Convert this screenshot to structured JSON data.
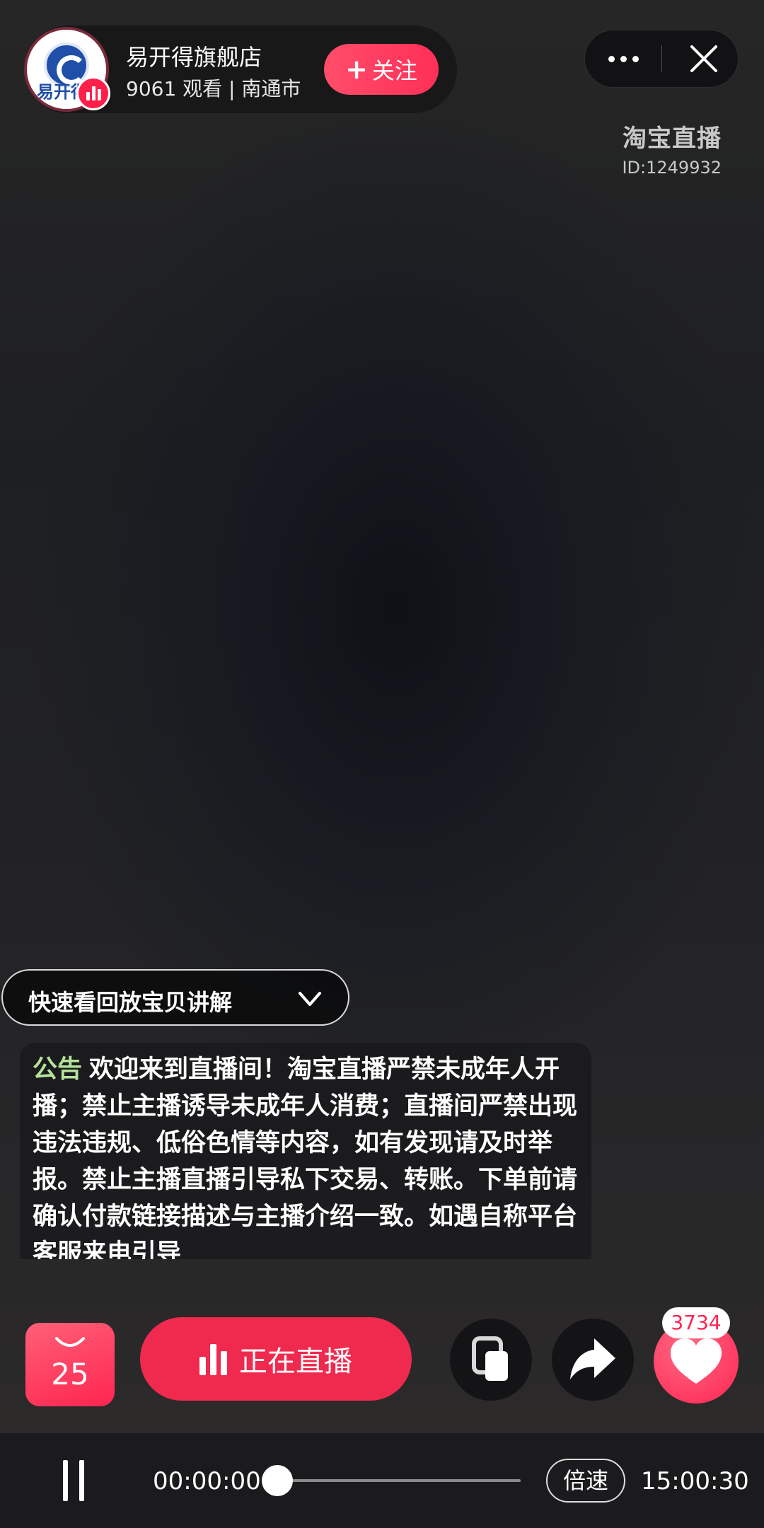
{
  "header": {
    "store_name": "易开得旗舰店",
    "viewers": "9061 观看",
    "location": "南通市",
    "meta_line": "9061 观看 |  南通市",
    "avatar_text": "易开得",
    "follow_label": "关注",
    "follow_plus": "+"
  },
  "brand": {
    "name": "淘宝直播",
    "id": "ID:1249932"
  },
  "replay": {
    "label": "快速看回放宝贝讲解"
  },
  "notice": {
    "tag": "公告",
    "text": "欢迎来到直播间！淘宝直播严禁未成年人开播；禁止主播诱导未成年人消费；直播间严禁出现违法违规、低俗色情等内容，如有发现请及时举报。禁止主播直播引导私下交易、转账。下单前请确认付款链接描述与主播介绍一致。如遇自称平台客服来电引导"
  },
  "actions": {
    "cart_count": "25",
    "live_label": "正在直播",
    "like_count": "3734"
  },
  "player": {
    "current_time": "00:00:00",
    "total_time": "15:00:30",
    "speed_label": "倍速",
    "progress": 0
  },
  "colors": {
    "accent": "#f02a4e",
    "notice_tag": "#b6e39a"
  }
}
